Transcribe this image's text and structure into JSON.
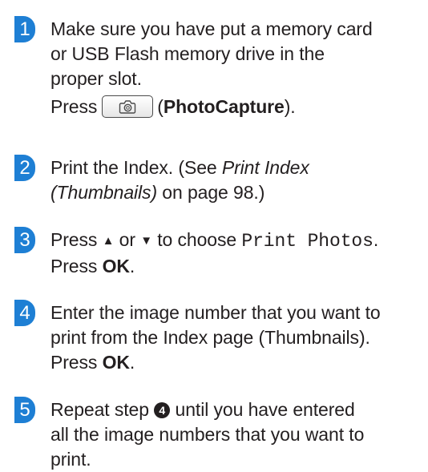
{
  "steps": [
    {
      "number": "1",
      "lines": [
        "Make sure you have put a memory card",
        "or USB Flash memory drive in the",
        "proper slot."
      ],
      "press": "Press",
      "button_label": "PhotoCapture",
      "open_paren": "(",
      "close_paren": ")."
    },
    {
      "number": "2",
      "intro": "Print the Index. (See ",
      "ref_title_1": "Print Index",
      "ref_title_2": "(Thumbnails)",
      "ref_suffix": " on page 98.)"
    },
    {
      "number": "3",
      "press": "Press",
      "up_arrow": "▲",
      "or": "or",
      "down_arrow": "▼",
      "to_choose": "to choose",
      "menu_option": "Print Photos",
      "period": ".",
      "press2": "Press",
      "ok": "OK",
      "ok_period": "."
    },
    {
      "number": "4",
      "lines": [
        "Enter the image number that you want to",
        "print from the Index page (Thumbnails)."
      ],
      "press": "Press",
      "ok": "OK",
      "ok_period": "."
    },
    {
      "number": "5",
      "line1_before": "Repeat step",
      "step_ref": "4",
      "line1_after": "until you have entered",
      "lines": [
        "all the image numbers that you want to",
        "print."
      ]
    }
  ],
  "colors": {
    "badge": "#1e7fd4",
    "text": "#231f20"
  },
  "icons": {
    "photocapture_button": "camera-icon"
  }
}
